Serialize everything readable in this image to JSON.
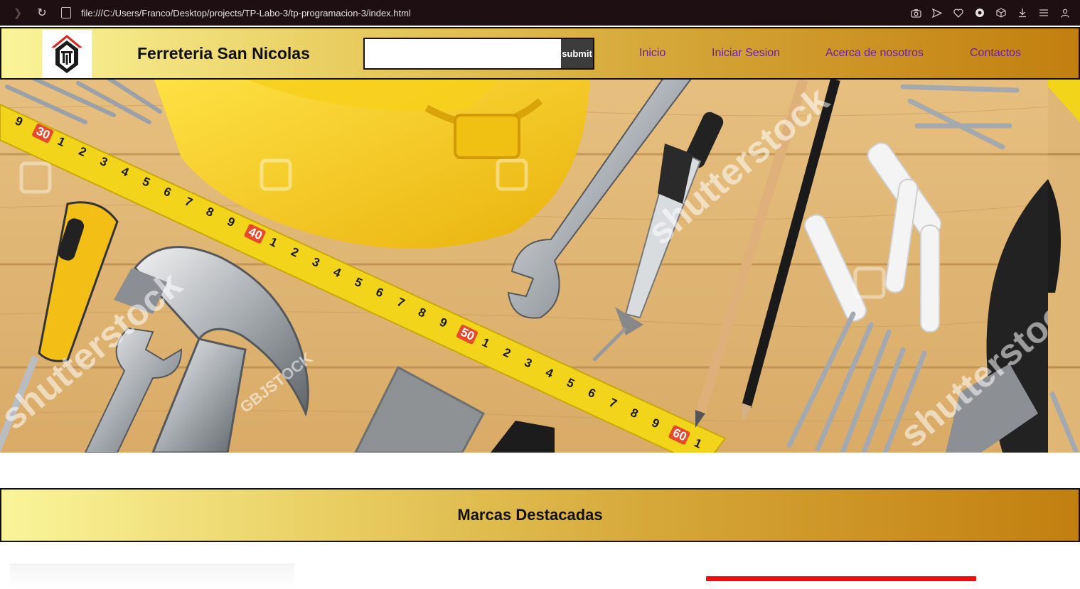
{
  "browser": {
    "url": "file:///C:/Users/Franco/Desktop/projects/TP-Labo-3/tp-programacion-3/index.html"
  },
  "header": {
    "title": "Ferreteria San Nicolas",
    "search_placeholder": "",
    "submit_label": "submit",
    "nav": [
      "Inicio",
      "Iniciar Sesion",
      "Acerca de nosotros",
      "Contactos"
    ]
  },
  "hero": {
    "ruler_numbers": [
      "9",
      "30",
      "1",
      "2",
      "3",
      "4",
      "5",
      "6",
      "7",
      "8",
      "9",
      "40",
      "1",
      "2",
      "3",
      "4",
      "5",
      "6",
      "7",
      "8",
      "9",
      "50",
      "1",
      "2",
      "3",
      "4",
      "5",
      "6",
      "7",
      "8",
      "9",
      "60",
      "1"
    ],
    "watermark": "shutterstock",
    "watermark_2": "GBJSTOCK"
  },
  "brands": {
    "title": "Marcas Destacadas"
  },
  "colors": {
    "header_gradient_start": "#faf59a",
    "header_gradient_end": "#c27f0f",
    "nav_link": "#6a1fa4",
    "accent_red": "#f10d0d"
  }
}
